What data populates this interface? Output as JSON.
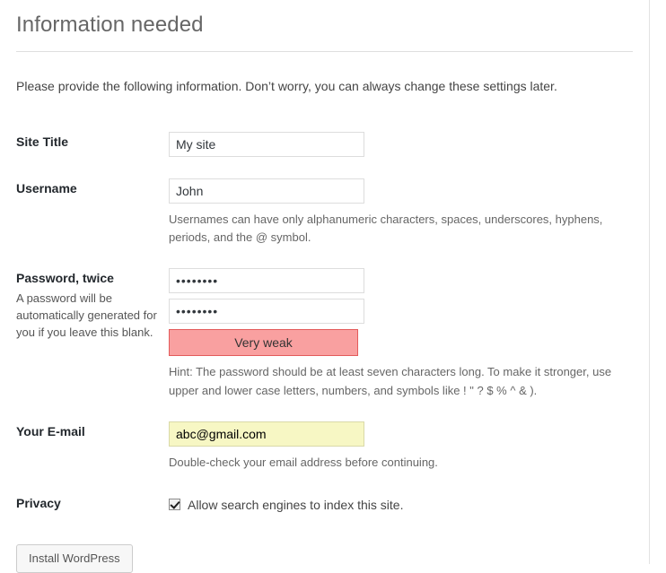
{
  "page": {
    "title": "Information needed",
    "intro": "Please provide the following information. Don’t worry, you can always change these settings later."
  },
  "fields": {
    "site_title": {
      "label": "Site Title",
      "value": "My site",
      "placeholder": ""
    },
    "username": {
      "label": "Username",
      "value": "John",
      "placeholder": "",
      "description": "Usernames can have only alphanumeric characters, spaces, underscores, hyphens, periods, and the @ symbol."
    },
    "password": {
      "label": "Password, twice",
      "label_note": "A password will be automatically generated for you if you leave this blank.",
      "value": "••••••••",
      "value_repeat": "••••••••",
      "placeholder": "",
      "placeholder_repeat": "",
      "strength_label": "Very weak",
      "strength_color": "#f9a0a0",
      "strength_border_color": "#e35b5b",
      "description": "Hint: The password should be at least seven characters long. To make it stronger, use upper and lower case letters, numbers, and symbols like ! \" ? $ % ^ & )."
    },
    "email": {
      "label": "Your E-mail",
      "value": "abc@gmail.com",
      "placeholder": "",
      "description": "Double-check your email address before continuing.",
      "autofill_color": "#f7f7c4"
    },
    "privacy": {
      "label": "Privacy",
      "checkbox_label": "Allow search engines to index this site.",
      "checked": true
    }
  },
  "submit": {
    "label": "Install WordPress"
  }
}
